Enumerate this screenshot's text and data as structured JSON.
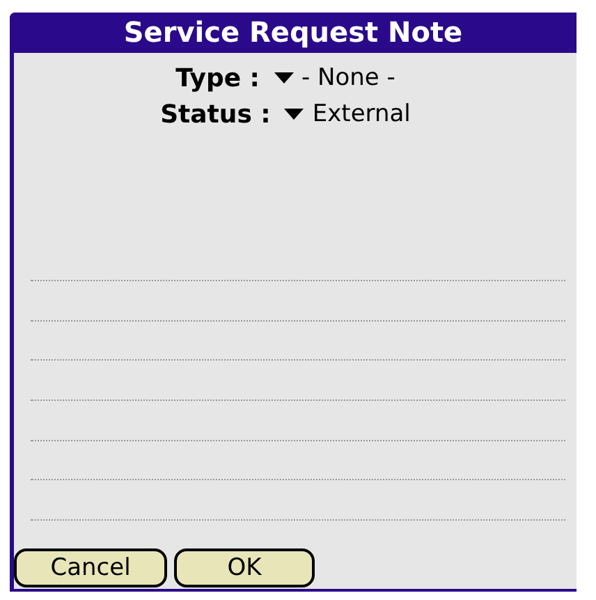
{
  "window": {
    "title": "Service Request Note"
  },
  "fields": [
    {
      "label": "Type :",
      "value": "- None -"
    },
    {
      "label": "Status :",
      "value": "External"
    }
  ],
  "buttons": [
    "Cancel",
    "OK"
  ]
}
